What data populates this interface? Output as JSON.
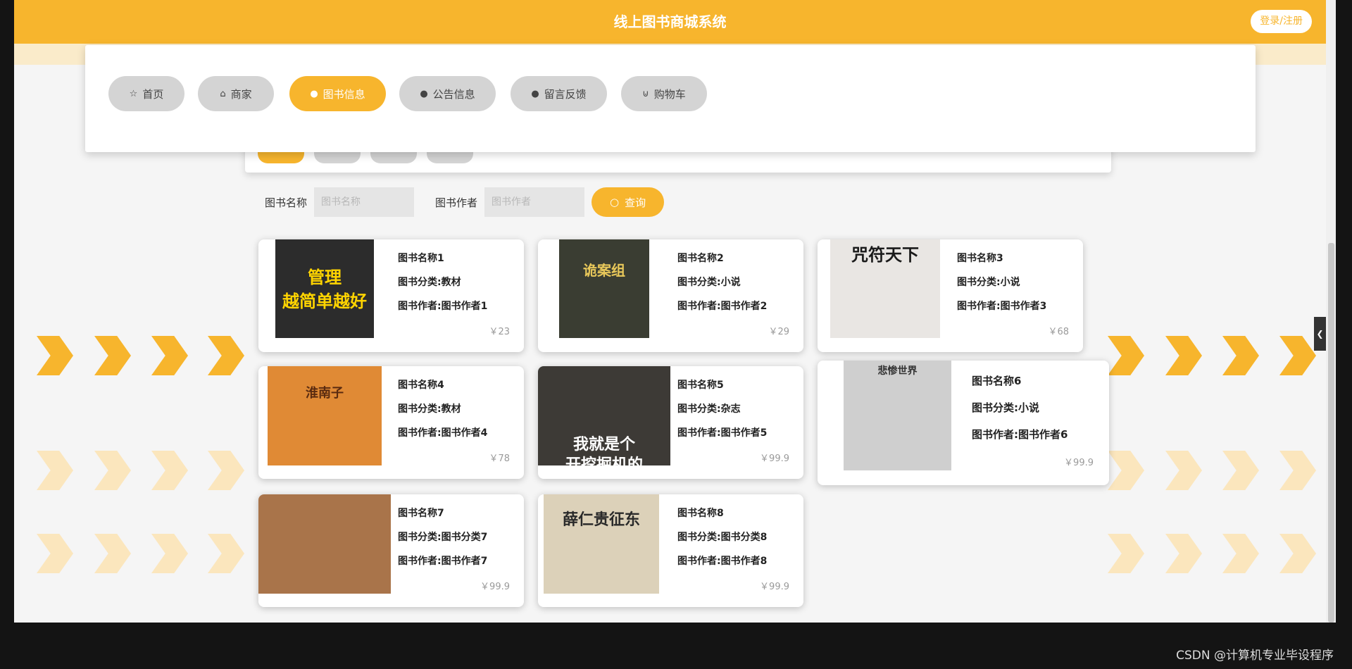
{
  "header": {
    "title": "线上图书商城系统",
    "login_label": "登录/注册"
  },
  "nav": [
    {
      "label": "首页",
      "icon": "☆"
    },
    {
      "label": "商家",
      "icon": "⌂"
    },
    {
      "label": "图书信息",
      "icon": "●"
    },
    {
      "label": "公告信息",
      "icon": "●"
    },
    {
      "label": "留言反馈",
      "icon": "●"
    },
    {
      "label": "购物车",
      "icon": "⊍"
    }
  ],
  "search": {
    "name_label": "图书名称",
    "name_placeholder": "图书名称",
    "author_label": "图书作者",
    "author_placeholder": "图书作者",
    "button_label": "查询",
    "button_icon": "○"
  },
  "books": [
    {
      "name": "图书名称1",
      "category": "图书分类:教材",
      "author": "图书作者:图书作者1",
      "price": "￥23",
      "cover_text": "管理\n越简单越好"
    },
    {
      "name": "图书名称2",
      "category": "图书分类:小说",
      "author": "图书作者:图书作者2",
      "price": "￥29",
      "cover_text": "诡案组"
    },
    {
      "name": "图书名称3",
      "category": "图书分类:小说",
      "author": "图书作者:图书作者3",
      "price": "￥68",
      "cover_text": "咒符天下"
    },
    {
      "name": "图书名称4",
      "category": "图书分类:教材",
      "author": "图书作者:图书作者4",
      "price": "￥78",
      "cover_text": "淮南子"
    },
    {
      "name": "图书名称5",
      "category": "图书分类:杂志",
      "author": "图书作者:图书作者5",
      "price": "￥99.9",
      "cover_text": "我就是个\n开挖掘机的"
    },
    {
      "name": "图书名称6",
      "category": "图书分类:小说",
      "author": "图书作者:图书作者6",
      "price": "￥99.9",
      "cover_text": "悲惨世界"
    },
    {
      "name": "图书名称7",
      "category": "图书分类:图书分类7",
      "author": "图书作者:图书作者7",
      "price": "￥99.9",
      "cover_text": ""
    },
    {
      "name": "图书名称8",
      "category": "图书分类:图书分类8",
      "author": "图书作者:图书作者8",
      "price": "￥99.9",
      "cover_text": "薛仁贵征东"
    }
  ],
  "footer": {
    "watermark": "CSDN @计算机专业毕设程序"
  },
  "colors": {
    "accent": "#f7b52d",
    "nav_inactive": "#d4d4d4",
    "page_bg": "#f5f5f5",
    "frame_bg": "#141414"
  }
}
